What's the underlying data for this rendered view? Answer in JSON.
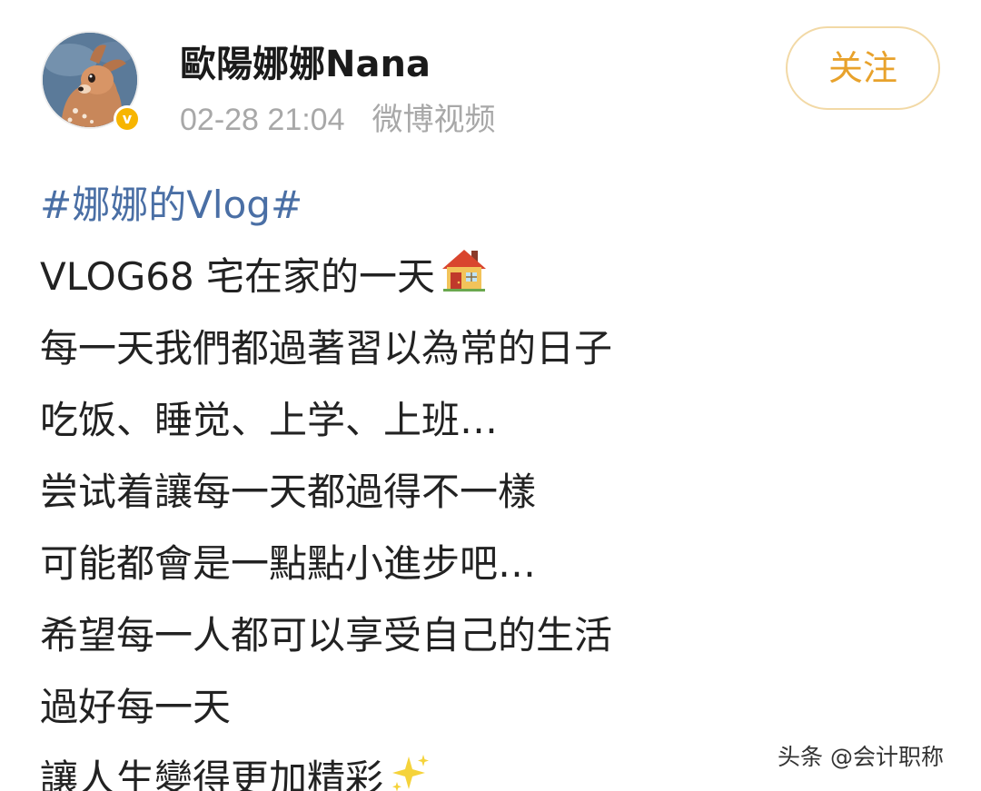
{
  "header": {
    "username": "歐陽娜娜Nana",
    "timestamp": "02-28 21:04",
    "source": "微博视频",
    "follow_label": "关注",
    "verified_mark": "v",
    "avatar_icon": "fawn-avatar-icon"
  },
  "post": {
    "hashtag": "#娜娜的Vlog#",
    "lines": [
      "VLOG68 宅在家的一天",
      "每一天我們都過著習以為常的日子",
      "吃饭、睡觉、上学、上班…",
      "尝试着讓每一天都過得不一樣",
      "可能都會是一點點小進步吧…",
      "希望每一人都可以享受自己的生活",
      "過好每一天",
      "讓人生變得更加精彩"
    ],
    "emojis": [
      "house-icon",
      "sparkles-icon"
    ]
  },
  "watermark": "头条 @会计职称",
  "colors": {
    "follow_text": "#e8a22c",
    "follow_border": "#f2d9a6",
    "hashtag": "#4a6fa5",
    "meta": "#a8a8a8",
    "verified_badge": "#f7b500"
  }
}
